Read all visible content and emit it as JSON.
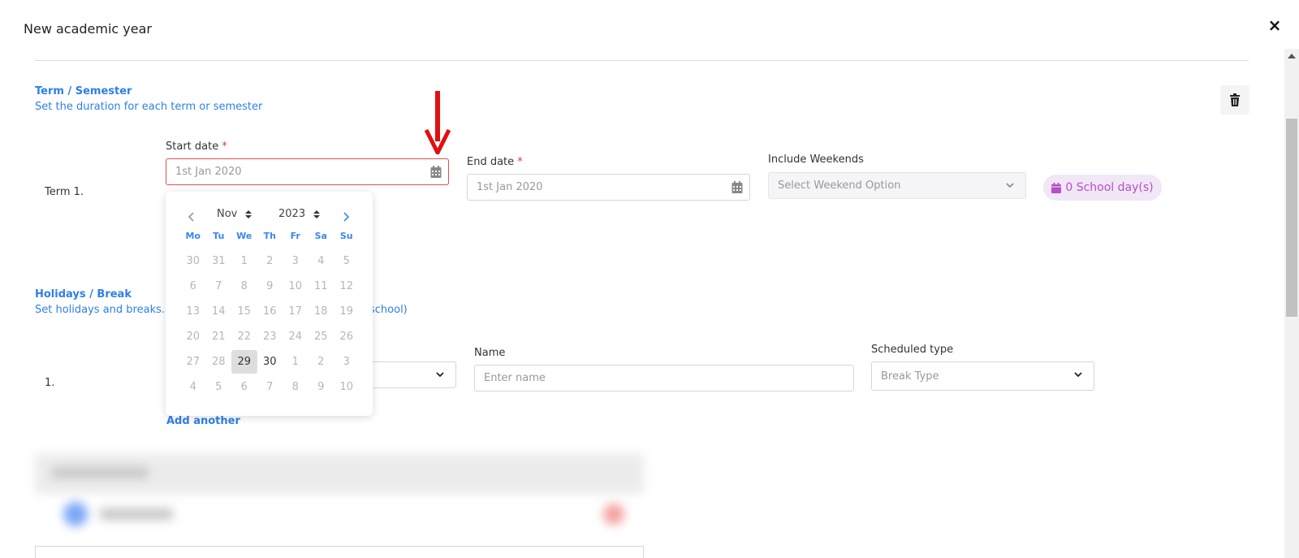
{
  "modal": {
    "title": "New academic year",
    "close": "×"
  },
  "term_section": {
    "title": "Term / Semester",
    "subtitle": "Set the duration for each term or semester",
    "row_label": "Term 1.",
    "start_label": "Start date",
    "start_value": "1st Jan 2020",
    "end_label": "End date",
    "end_value": "1st Jan 2020",
    "weekends_label": "Include Weekends",
    "weekends_placeholder": "Select Weekend Option",
    "school_days": "0 School day(s)",
    "required_mark": "*"
  },
  "holiday_section": {
    "title": "Holidays / Break",
    "subtitle_start": "Set holidays and breaks. (",
    "subtitle_end": "school)",
    "row_label": "1.",
    "name_label": "Name",
    "name_placeholder": "Enter name",
    "type_label": "Scheduled type",
    "type_placeholder": "Break Type",
    "add_another": "Add another"
  },
  "datepicker": {
    "month": "Nov",
    "year": "2023",
    "weekdays": [
      "Mo",
      "Tu",
      "We",
      "Th",
      "Fr",
      "Sa",
      "Su"
    ],
    "weeks": [
      [
        "30",
        "31",
        "1",
        "2",
        "3",
        "4",
        "5"
      ],
      [
        "6",
        "7",
        "8",
        "9",
        "10",
        "11",
        "12"
      ],
      [
        "13",
        "14",
        "15",
        "16",
        "17",
        "18",
        "19"
      ],
      [
        "20",
        "21",
        "22",
        "23",
        "24",
        "25",
        "26"
      ],
      [
        "27",
        "28",
        "29",
        "30",
        "1",
        "2",
        "3"
      ],
      [
        "4",
        "5",
        "6",
        "7",
        "8",
        "9",
        "10"
      ]
    ],
    "today": "29",
    "enabled": [
      "29",
      "30"
    ]
  },
  "colors": {
    "accent": "#2e7fe8",
    "badge": "#b64fc8",
    "error": "#e05050",
    "arrow": "#e01010"
  }
}
